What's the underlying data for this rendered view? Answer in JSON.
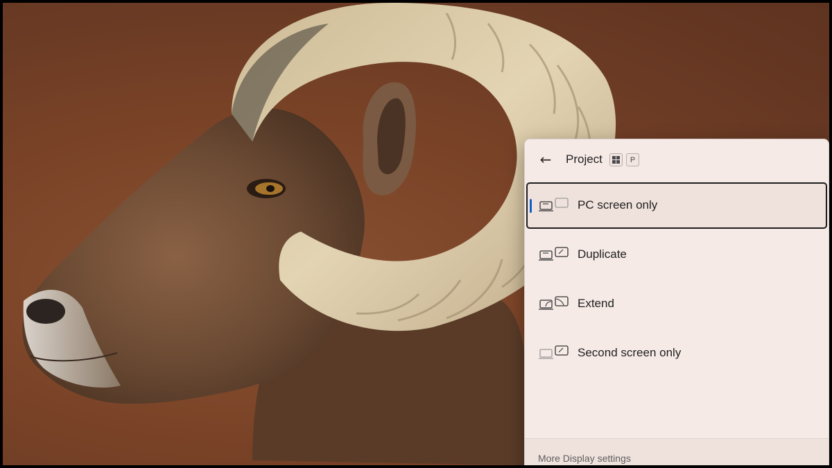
{
  "flyout": {
    "title": "Project",
    "shortcut_keys": [
      "win-key",
      "P"
    ],
    "options": [
      {
        "label": "PC screen only",
        "icon": "pc-screen-only-icon",
        "selected": true
      },
      {
        "label": "Duplicate",
        "icon": "duplicate-icon",
        "selected": false
      },
      {
        "label": "Extend",
        "icon": "extend-icon",
        "selected": false
      },
      {
        "label": "Second screen only",
        "icon": "second-screen-only-icon",
        "selected": false
      }
    ],
    "footer_link": "More Display settings"
  },
  "colors": {
    "accent": "#1160c7",
    "flyout_bg": "#f5eae6",
    "wallpaper_bg": "#7a4327"
  }
}
